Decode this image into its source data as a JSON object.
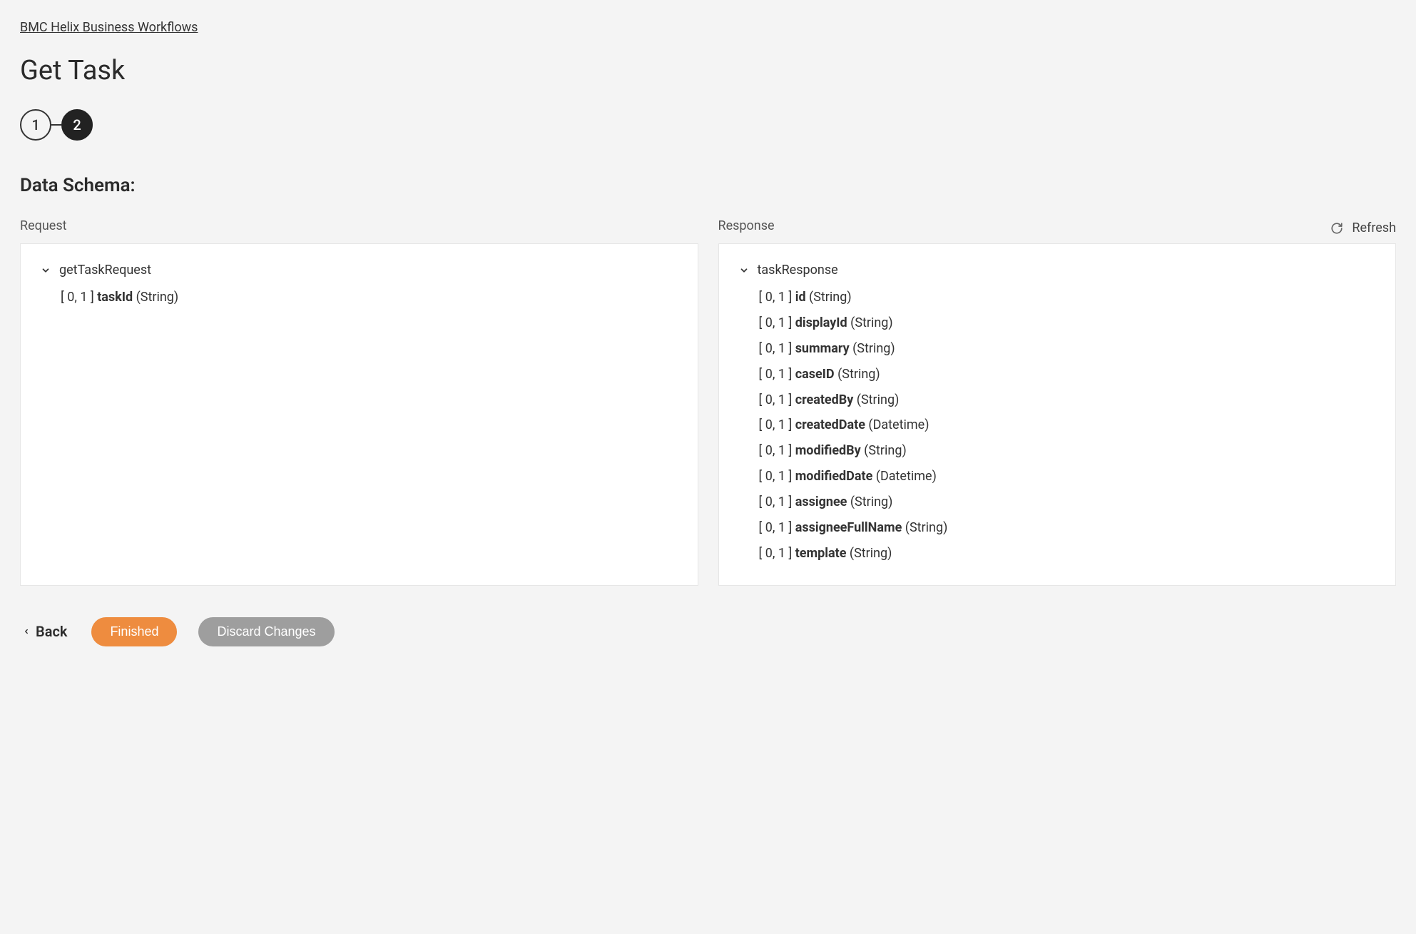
{
  "breadcrumb": "BMC Helix Business Workflows",
  "title": "Get Task",
  "stepper": {
    "step1": "1",
    "step2": "2"
  },
  "section_title": "Data Schema:",
  "refresh_label": "Refresh",
  "request": {
    "label": "Request",
    "root": "getTaskRequest",
    "fields": [
      {
        "card": "[ 0, 1 ]",
        "name": "taskId",
        "type": "(String)"
      }
    ]
  },
  "response": {
    "label": "Response",
    "root": "taskResponse",
    "fields": [
      {
        "card": "[ 0, 1 ]",
        "name": "id",
        "type": "(String)"
      },
      {
        "card": "[ 0, 1 ]",
        "name": "displayId",
        "type": "(String)"
      },
      {
        "card": "[ 0, 1 ]",
        "name": "summary",
        "type": "(String)"
      },
      {
        "card": "[ 0, 1 ]",
        "name": "caseID",
        "type": "(String)"
      },
      {
        "card": "[ 0, 1 ]",
        "name": "createdBy",
        "type": "(String)"
      },
      {
        "card": "[ 0, 1 ]",
        "name": "createdDate",
        "type": "(Datetime)"
      },
      {
        "card": "[ 0, 1 ]",
        "name": "modifiedBy",
        "type": "(String)"
      },
      {
        "card": "[ 0, 1 ]",
        "name": "modifiedDate",
        "type": "(Datetime)"
      },
      {
        "card": "[ 0, 1 ]",
        "name": "assignee",
        "type": "(String)"
      },
      {
        "card": "[ 0, 1 ]",
        "name": "assigneeFullName",
        "type": "(String)"
      },
      {
        "card": "[ 0, 1 ]",
        "name": "template",
        "type": "(String)"
      }
    ]
  },
  "footer": {
    "back": "Back",
    "finished": "Finished",
    "discard": "Discard Changes"
  }
}
